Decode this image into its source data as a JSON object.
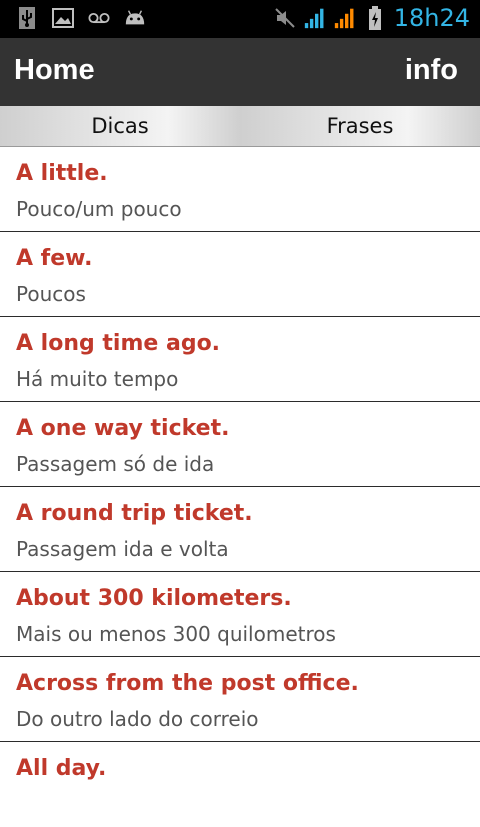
{
  "status_bar": {
    "icons_left": [
      "usb-icon",
      "image-icon",
      "voicemail-icon",
      "android-icon"
    ],
    "icons_right": [
      "mute-icon",
      "signal-icon",
      "signal-icon",
      "battery-charging-icon"
    ],
    "time": "18h24",
    "time_color": "#33b5e5"
  },
  "action_bar": {
    "title": "Home",
    "info_label": "info",
    "background": "#333333"
  },
  "tabs": [
    {
      "label": "Dicas"
    },
    {
      "label": "Frases"
    }
  ],
  "phrases": [
    {
      "english": "A little.",
      "portuguese": "Pouco/um pouco"
    },
    {
      "english": "A few.",
      "portuguese": "Poucos"
    },
    {
      "english": "A long time ago.",
      "portuguese": "Há muito tempo"
    },
    {
      "english": "A one way ticket.",
      "portuguese": "Passagem só de ida"
    },
    {
      "english": "A round trip ticket.",
      "portuguese": "Passagem ida e volta"
    },
    {
      "english": "About 300 kilometers.",
      "portuguese": "Mais ou menos 300 quilometros"
    },
    {
      "english": "Across from the post office.",
      "portuguese": "Do outro lado do correio"
    },
    {
      "english": "All day.",
      "portuguese": ""
    }
  ],
  "colors": {
    "phrase_title": "#c0392b",
    "phrase_translation": "#555555",
    "signal_blue": "#33b5e5",
    "signal_orange": "#ff8a00"
  }
}
